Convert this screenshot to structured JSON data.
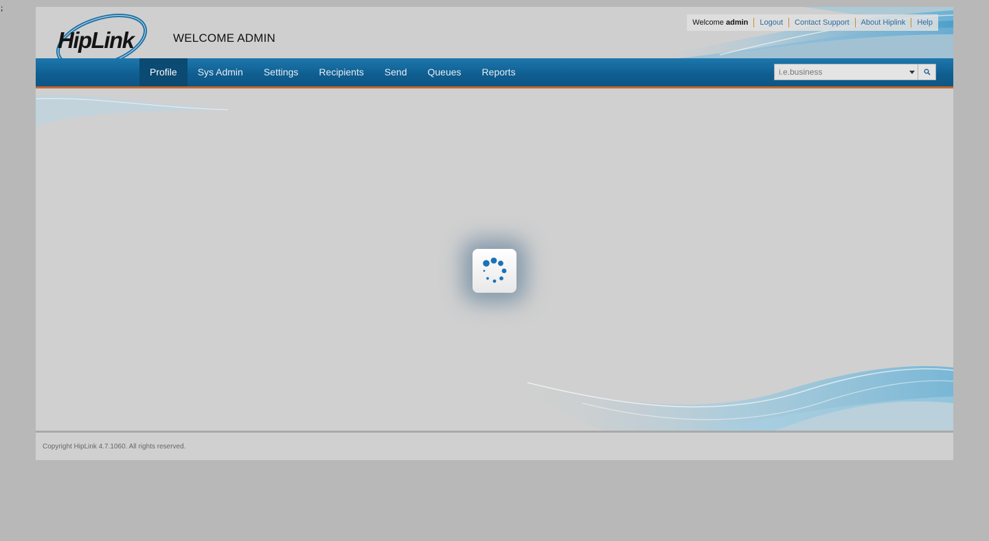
{
  "stray_char": ";",
  "header": {
    "logo_text": "HipLink",
    "title": "WELCOME ADMIN",
    "welcome_prefix": "Welcome",
    "welcome_user": "admin",
    "links": [
      "Logout",
      "Contact Support",
      "About Hiplink",
      "Help"
    ]
  },
  "nav": {
    "items": [
      "Profile",
      "Sys Admin",
      "Settings",
      "Recipients",
      "Send",
      "Queues",
      "Reports"
    ],
    "active": "Profile"
  },
  "search": {
    "placeholder": "i.e.business",
    "button_icon": "search-icon",
    "dropdown_icon": "chevron-down-icon"
  },
  "loading": {
    "icon": "loading-spinner-icon"
  },
  "footer": {
    "copyright": "Copyright HipLink 4.7.1060. All rights reserved."
  },
  "colors": {
    "nav_bg": "#0f5d8f",
    "nav_active": "#0b4a72",
    "nav_border": "#c9672b",
    "link": "#2b6a9b",
    "link_separator": "#c98a2a",
    "spinner": "#1a72b8"
  }
}
